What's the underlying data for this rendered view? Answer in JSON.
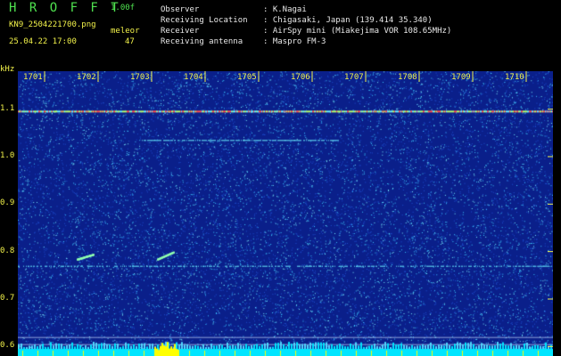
{
  "header": {
    "title": "H R O F F T",
    "version": "1.00f",
    "filename": "KN9_2504221700.png",
    "mode": "meleor",
    "datetime": "25.04.22 17:00",
    "count": "47",
    "info_labels": [
      "Observer",
      "Receiving Location",
      "Receiver",
      "Receiving antenna"
    ],
    "info_values": [
      ": K.Nagai",
      ": Chigasaki, Japan (139.414 35.340)",
      ": AirSpy mini (Miakejima VOR 108.65MHz)",
      ": Maspro FM-3"
    ]
  },
  "chart_data": {
    "type": "heatmap",
    "ylabel": "kHz",
    "x_tick_labels": [
      "1701",
      "1702",
      "1703",
      "1704",
      "1705",
      "1706",
      "1707",
      "1708",
      "1709",
      "1710"
    ],
    "y_tick_labels": [
      "1.1",
      "1.0",
      "0.9",
      "0.8",
      "0.7",
      "0.6"
    ],
    "y_ticks": [
      1.1,
      1.0,
      0.9,
      0.8,
      0.7,
      0.6
    ],
    "ylim": [
      0.58,
      1.18
    ],
    "x_range_minutes": [
      0,
      10
    ],
    "carrier_khz": 1.095,
    "secondary_line_khz": 1.035,
    "mid_line_khz": 0.77,
    "low_lines_khz": [
      0.62,
      0.605
    ],
    "meteor_echoes": [
      {
        "minute_start": 1.1,
        "minute_end": 1.4,
        "khz_start": 0.785,
        "khz_end": 0.795
      },
      {
        "minute_start": 2.6,
        "minute_end": 2.9,
        "khz_start": 0.785,
        "khz_end": 0.8
      }
    ],
    "colors": {
      "background": "#0a1f8a",
      "noise": "#3cc8ff",
      "carrier": "#ff5050",
      "base": "#00e5ff",
      "burst": "#ffff00"
    }
  }
}
